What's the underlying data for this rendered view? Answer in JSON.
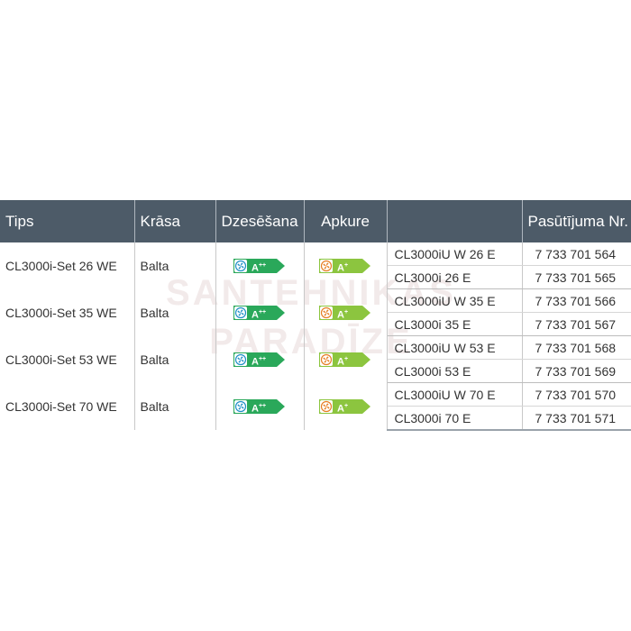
{
  "watermark": {
    "line1": "SANTEHNIKAS",
    "line2": "PARADĪZE"
  },
  "table": {
    "headers": [
      "Tips",
      "Krāsa",
      "Dzesēšana",
      "Apkure",
      "",
      "Pasūtījuma Nr."
    ],
    "groups": [
      {
        "type": "CL3000i-Set 26 WE",
        "color": "Balta",
        "cooling": "A++",
        "heating": "A+",
        "units": [
          {
            "model": "CL3000iU W 26 E",
            "order": "7 733 701 564"
          },
          {
            "model": "CL3000i 26 E",
            "order": "7 733 701 565"
          }
        ]
      },
      {
        "type": "CL3000i-Set 35 WE",
        "color": "Balta",
        "cooling": "A++",
        "heating": "A+",
        "units": [
          {
            "model": "CL3000iU W 35 E",
            "order": "7 733 701 566"
          },
          {
            "model": "CL3000i 35 E",
            "order": "7 733 701 567"
          }
        ]
      },
      {
        "type": "CL3000i-Set 53 WE",
        "color": "Balta",
        "cooling": "A++",
        "heating": "A+",
        "units": [
          {
            "model": "CL3000iU W 53 E",
            "order": "7 733 701 568"
          },
          {
            "model": "CL3000i 53 E",
            "order": "7 733 701 569"
          }
        ]
      },
      {
        "type": "CL3000i-Set 70 WE",
        "color": "Balta",
        "cooling": "A++",
        "heating": "A+",
        "units": [
          {
            "model": "CL3000iU W 70 E",
            "order": "7 733 701 570"
          },
          {
            "model": "CL3000i 70 E",
            "order": "7 733 701 571"
          }
        ]
      }
    ]
  },
  "colors": {
    "header_bg": "#4d5b68",
    "cooling_label": "#2aa85a",
    "heating_label": "#8cc53f",
    "cooling_icon": "#1e8fc6",
    "heating_icon": "#e67e22"
  }
}
